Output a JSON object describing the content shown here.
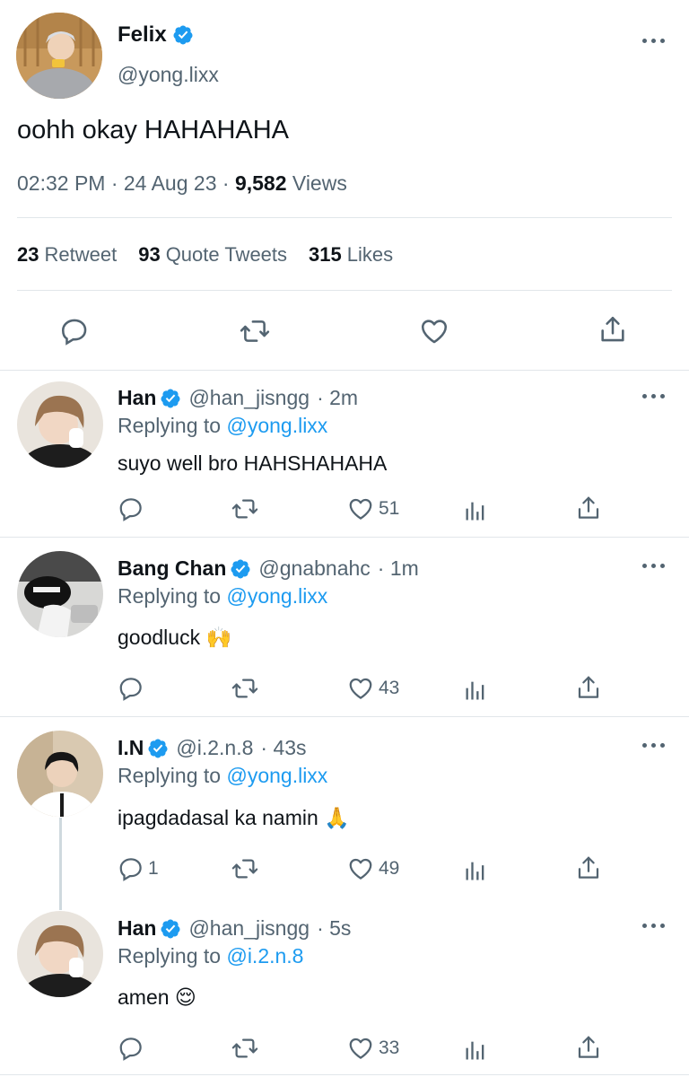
{
  "main": {
    "name": "Felix",
    "handle": "@yong.lixx",
    "text": "oohh okay HAHAHAHA",
    "time": "02:32 PM · 24 Aug 23 · ",
    "views_count": "9,582",
    "views_label": " Views",
    "retweets": "23",
    "retweets_label": "Retweet",
    "quotes": "93",
    "quotes_label": "Quote Tweets",
    "likes": "315",
    "likes_label": "Likes"
  },
  "replies": [
    {
      "name": "Han",
      "handle": "@han_jisngg",
      "time": "· 2m",
      "replying_label": "Replying to ",
      "replying_to": "@yong.lixx",
      "text": "suyo well bro HAHSHAHAHA",
      "reply_count": "",
      "like_count": "51"
    },
    {
      "name": "Bang Chan",
      "handle": "@gnabnahc",
      "time": "· 1m",
      "replying_label": "Replying to ",
      "replying_to": "@yong.lixx",
      "text": "goodluck 🙌",
      "reply_count": "",
      "like_count": "43"
    },
    {
      "name": "I.N",
      "handle": "@i.2.n.8",
      "time": "· 43s",
      "replying_label": "Replying to ",
      "replying_to": "@yong.lixx",
      "text": "ipagdadasal ka namin 🙏",
      "reply_count": "1",
      "like_count": "49"
    },
    {
      "name": "Han",
      "handle": "@han_jisngg",
      "time": "· 5s",
      "replying_label": "Replying to ",
      "replying_to": "@i.2.n.8",
      "text": "amen 😌",
      "reply_count": "",
      "like_count": "33"
    }
  ],
  "colors": {
    "accent": "#1d9bf0",
    "muted": "#536471",
    "text": "#0f1419"
  },
  "icons": [
    "verified-badge-icon",
    "more-icon",
    "reply-icon",
    "retweet-icon",
    "like-icon",
    "share-icon",
    "analytics-icon"
  ]
}
